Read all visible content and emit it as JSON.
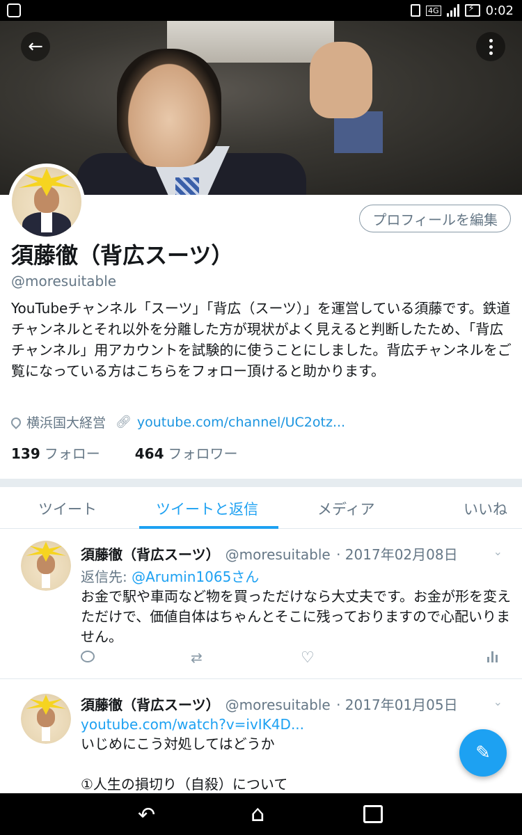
{
  "status_bar": {
    "network": "4G",
    "time": "0:02"
  },
  "profile": {
    "edit_button": "プロフィールを編集",
    "name": "須藤徹（背広スーツ）",
    "handle": "@moresuitable",
    "bio": "YouTubeチャンネル「スーツ」「背広（スーツ）」を運営している須藤です。鉄道チャンネルとそれ以外を分離した方が現状がよく見えると判断したため、「背広チャンネル」用アカウントを試験的に使うことにしました。背広チャンネルをご覧になっている方はこちらをフォロー頂けると助かります。",
    "location": "横浜国大経営",
    "url": "youtube.com/channel/UC2otz...",
    "following_count": "139",
    "following_label": "フォロー",
    "followers_count": "464",
    "followers_label": "フォロワー"
  },
  "tabs": [
    {
      "label": "ツイート",
      "active": false
    },
    {
      "label": "ツイートと返信",
      "active": true
    },
    {
      "label": "メディア",
      "active": false
    },
    {
      "label": "いいね",
      "active": false
    }
  ],
  "tweets": [
    {
      "name": "須藤徹（背広スーツ）",
      "handle": "@moresuitable",
      "date": "· 2017年02月08日",
      "reply_prefix": "返信先:",
      "reply_mention": "@Arumin1065さん",
      "text": "お金で駅や車両など物を買っただけなら大丈夫です。お金が形を変えただけで、価値自体はちゃんとそこに残っておりますので心配いりません。"
    },
    {
      "name": "須藤徹（背広スーツ）",
      "handle": "@moresuitable",
      "date": "· 2017年01月05日",
      "link": "youtube.com/watch?v=ivIK4D...",
      "text_line1": "いじめにこう対処してはどうか",
      "text_line2": "①人生の損切り（自殺）について"
    }
  ],
  "icons": {
    "back": "arrow-left-icon",
    "more": "more-vertical-icon",
    "compose": "compose-tweet-icon"
  },
  "colors": {
    "accent": "#1da1f2",
    "secondary_text": "#657786"
  }
}
